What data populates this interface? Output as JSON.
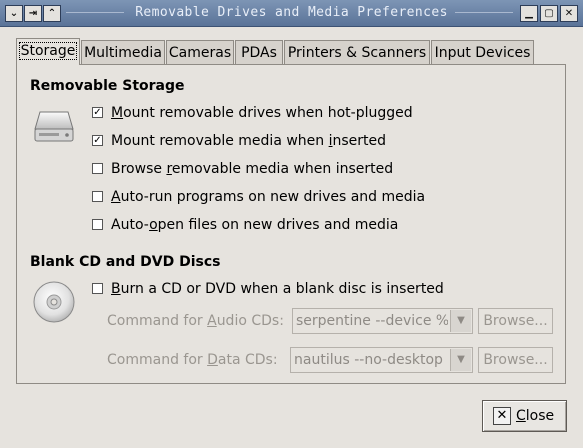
{
  "window": {
    "title": "Removable Drives and Media Preferences",
    "controls": {
      "menu_glyph": "⌄",
      "pin_glyph": "⇥",
      "shade_glyph": "⌃",
      "minimize_glyph": "▁",
      "maximize_glyph": "▢",
      "close_glyph": "✕"
    }
  },
  "tabs": [
    {
      "label": "Storage",
      "active": true
    },
    {
      "label": "Multimedia",
      "active": false
    },
    {
      "label": "Cameras",
      "active": false
    },
    {
      "label": "PDAs",
      "active": false
    },
    {
      "label": "Printers & Scanners",
      "active": false
    },
    {
      "label": "Input Devices",
      "active": false
    }
  ],
  "removable_storage": {
    "heading": "Removable Storage",
    "options": [
      {
        "pre": "",
        "key": "M",
        "post": "ount removable drives when hot-plugged",
        "checked": true,
        "mark": "✓"
      },
      {
        "pre": "Mount removable media when ",
        "key": "i",
        "post": "nserted",
        "checked": true,
        "mark": "✓"
      },
      {
        "pre": "Browse ",
        "key": "r",
        "post": "emovable media when inserted",
        "checked": false,
        "mark": ""
      },
      {
        "pre": "",
        "key": "A",
        "post": "uto-run programs on new drives and media",
        "checked": false,
        "mark": ""
      },
      {
        "pre": "Auto-",
        "key": "o",
        "post": "pen files on new drives and media",
        "checked": false,
        "mark": ""
      }
    ]
  },
  "blank_discs": {
    "heading": "Blank CD and DVD Discs",
    "option": {
      "pre": "",
      "key": "B",
      "post": "urn a CD or DVD when a blank disc is inserted",
      "checked": false,
      "mark": ""
    },
    "audio_label_pre": "Command for ",
    "audio_label_key": "A",
    "audio_label_post": "udio CDs:",
    "audio_command": "serpentine --device %d",
    "data_label_pre": "Command for ",
    "data_label_key": "D",
    "data_label_post": "ata CDs:",
    "data_command": "nautilus --no-desktop burn:",
    "browse_label": "Browse..."
  },
  "footer": {
    "close_key": "C",
    "close_rest": "lose",
    "close_icon": "✕"
  },
  "icons": {
    "drive": "harddisk-icon",
    "disc": "cd-disc-icon"
  }
}
